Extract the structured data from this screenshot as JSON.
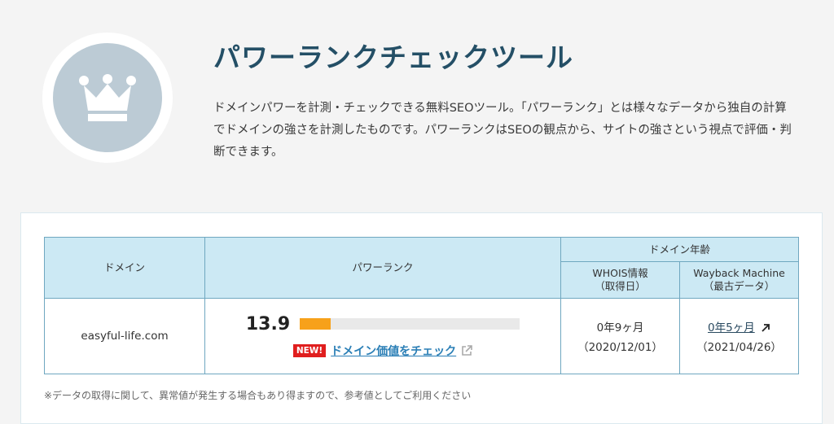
{
  "header": {
    "icon": "crown-icon",
    "title": "パワーランクチェックツール",
    "description": "ドメインパワーを計測・チェックできる無料SEOツール。「パワーランク」とは様々なデータから独自の計算でドメインの強さを計測したものです。パワーランクはSEOの観点から、サイトの強さという視点で評価・判断できます。"
  },
  "table": {
    "headers": {
      "domain": "ドメイン",
      "power_rank": "パワーランク",
      "domain_age": "ドメイン年齢",
      "whois": "WHOIS情報\n（取得日）",
      "wayback": "Wayback Machine\n（最古データ）"
    },
    "row": {
      "domain": "easyful-life.com",
      "score": "13.9",
      "score_fraction": 0.139,
      "new_badge": "NEW!",
      "check_link": "ドメイン価値をチェック",
      "whois_age": "0年9ヶ月",
      "whois_date": "（2020/12/01）",
      "wayback_age": "0年5ヶ月",
      "wayback_date": "（2021/04/26）"
    }
  },
  "note": "※データの取得に関して、異常値が発生する場合もあり得ますので、参考値としてご利用ください",
  "colors": {
    "title": "#244f66",
    "header_bg": "#cce9f4",
    "bar_fill": "#f7a11a",
    "new_badge": "#e01e1e",
    "link": "#2b7fb6"
  }
}
